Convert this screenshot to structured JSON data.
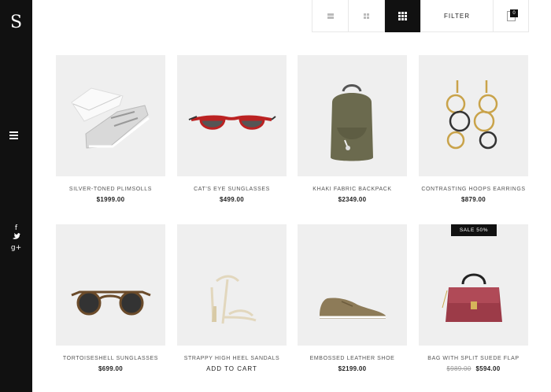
{
  "sidebar": {
    "logo": "S",
    "social": [
      "f",
      "t",
      "g+"
    ]
  },
  "toolbar": {
    "filter_label": "FILTER",
    "cart_count": "0"
  },
  "products": [
    {
      "name": "SILVER-TONED PLIMSOLLS",
      "price": "$1999.00"
    },
    {
      "name": "CAT'S EYE SUNGLASSES",
      "price": "$499.00"
    },
    {
      "name": "KHAKI FABRIC BACKPACK",
      "price": "$2349.00"
    },
    {
      "name": "CONTRASTING HOOPS EARRINGS",
      "price": "$879.00"
    },
    {
      "name": "TORTOISESHELL SUNGLASSES",
      "price": "$699.00"
    },
    {
      "name": "STRAPPY HIGH HEEL SANDALS",
      "cta": "ADD TO CART"
    },
    {
      "name": "EMBOSSED LEATHER SHOE",
      "price": "$2199.00"
    },
    {
      "name": "BAG WITH SPLIT SUEDE FLAP",
      "old_price": "$989.00",
      "price": "$594.00",
      "badge": "SALE 50%"
    }
  ],
  "colors": {
    "sidebar_bg": "#111111",
    "active_view_bg": "#111111",
    "image_bg": "#efefef"
  }
}
